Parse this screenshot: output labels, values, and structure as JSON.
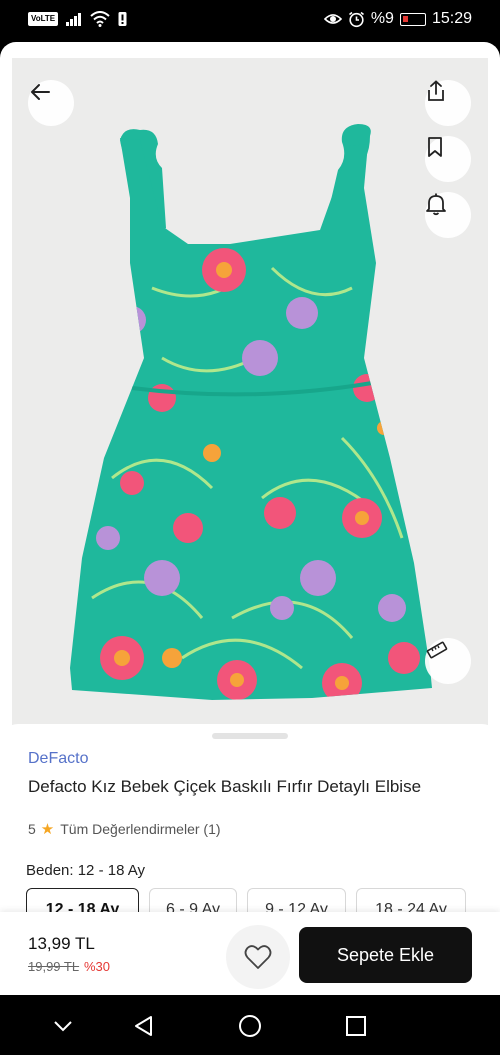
{
  "status_bar": {
    "volte": "VoLTE",
    "battery_percent": "%9",
    "time": "15:29"
  },
  "product": {
    "brand": "DeFacto",
    "title": "Defacto Kız Bebek Çiçek Baskılı Fırfır Detaylı Elbise",
    "rating_value": "5",
    "reviews_label": "Tüm Değerlendirmeler (1)",
    "size_label_prefix": "Beden:",
    "selected_size": "12 - 18 Ay",
    "sizes": [
      {
        "label": "12 - 18 Ay",
        "selected": true
      },
      {
        "label": "6 - 9 Ay",
        "selected": false
      },
      {
        "label": "9 - 12 Ay",
        "selected": false
      },
      {
        "label": "18 - 24 Ay",
        "selected": false
      }
    ]
  },
  "buy_bar": {
    "price": "13,99 TL",
    "old_price": "19,99 TL",
    "discount": "%30",
    "add_to_cart": "Sepete Ekle"
  },
  "icons": {
    "back": "back-arrow-icon",
    "share": "share-icon",
    "bookmark": "bookmark-icon",
    "notify": "bell-icon",
    "size_guide": "ruler-icon",
    "favorite": "heart-icon"
  },
  "colors": {
    "brand": "#5672c9",
    "star": "#f5a623",
    "discount": "#e53935",
    "cart_button": "#111111",
    "dress_base": "#1fb89c"
  }
}
